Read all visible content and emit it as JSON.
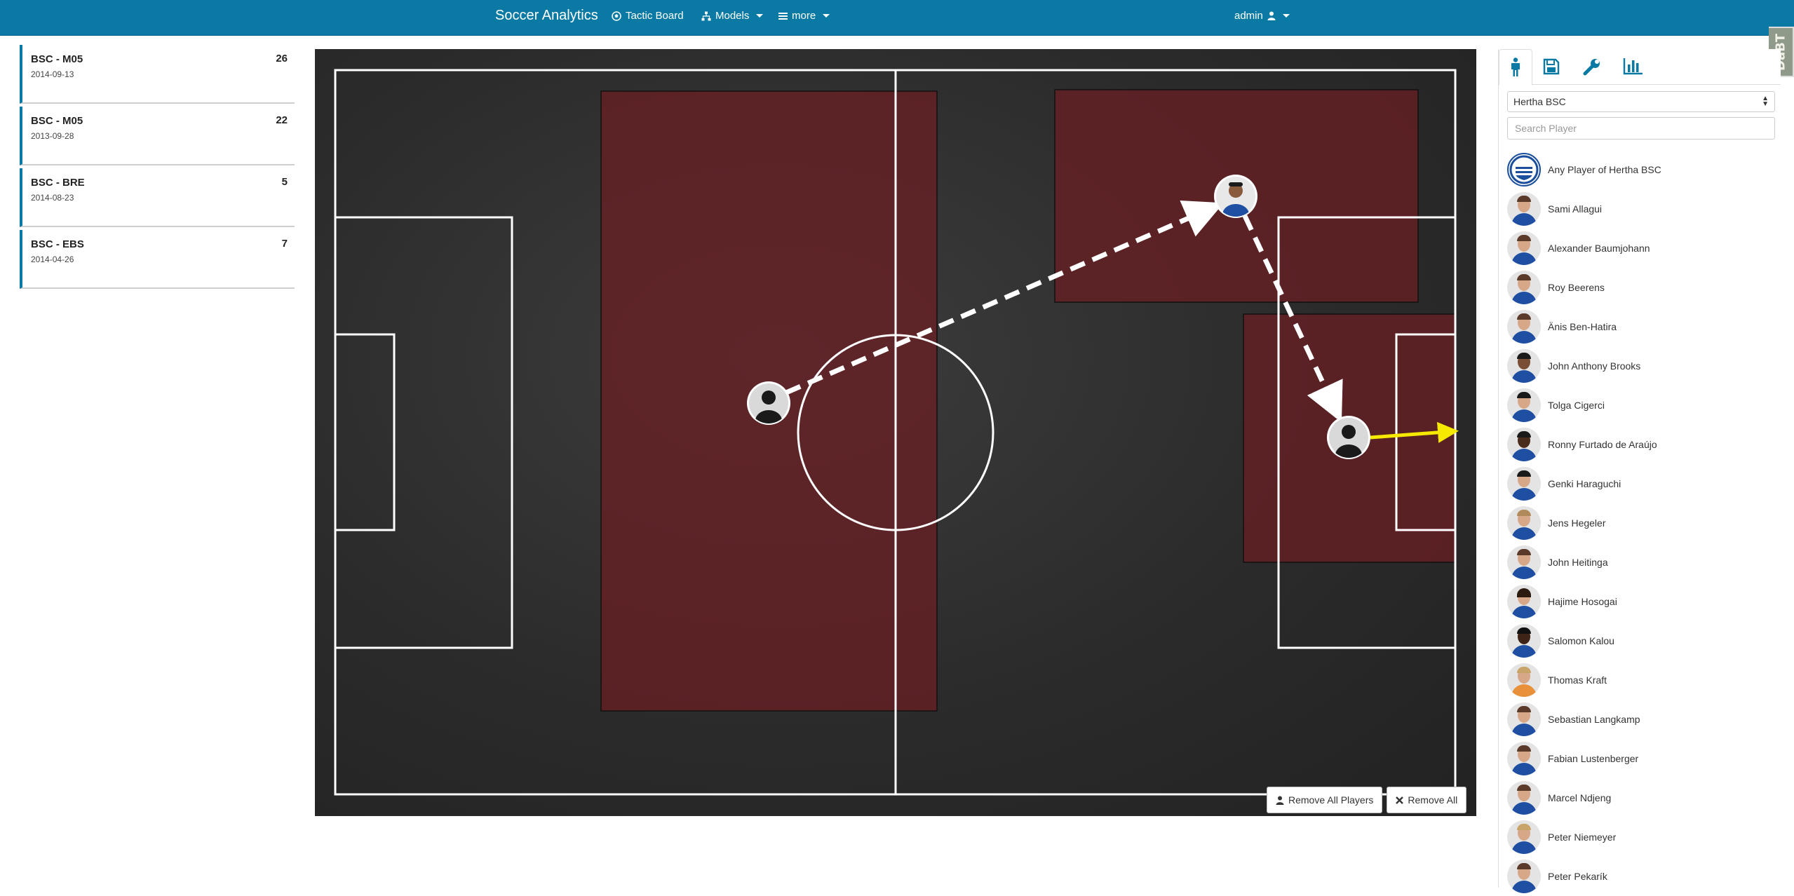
{
  "navbar": {
    "brand": "Soccer Analytics",
    "tactic_board": "Tactic Board",
    "models": "Models",
    "more": "more",
    "user": "admin",
    "corner_badge": "DaBT"
  },
  "matches": [
    {
      "title": "BSC - M05",
      "date": "2014-09-13",
      "count": "26"
    },
    {
      "title": "BSC - M05",
      "date": "2013-09-28",
      "count": "22"
    },
    {
      "title": "BSC - BRE",
      "date": "2014-08-23",
      "count": "5"
    },
    {
      "title": "BSC - EBS",
      "date": "2014-04-26",
      "count": "7"
    }
  ],
  "actions": {
    "remove_all_players": "Remove All Players",
    "remove_all": "Remove All"
  },
  "sidebar": {
    "tabs": [
      "player-icon",
      "save-icon",
      "wrench-icon",
      "bar-chart-icon"
    ],
    "team": "Hertha BSC",
    "search_placeholder": "Search Player",
    "any_player": "Any Player of Hertha BSC",
    "players": [
      "Sami Allagui",
      "Alexander Baumjohann",
      "Roy Beerens",
      "Änis Ben-Hatira",
      "John Anthony Brooks",
      "Tolga Cigerci",
      "Ronny Furtado de Araújo",
      "Genki Haraguchi",
      "Jens Hegeler",
      "John Heitinga",
      "Hajime Hosogai",
      "Salomon Kalou",
      "Thomas Kraft",
      "Sebastian Langkamp",
      "Fabian Lustenberger",
      "Marcel Ndjeng",
      "Peter Niemeyer",
      "Peter Pekarík"
    ]
  },
  "colors": {
    "navbar": "#0a7aa5",
    "zone": "#6b1f24",
    "pass_arrow": "#ffffff",
    "shot_arrow": "#f5ea00"
  }
}
